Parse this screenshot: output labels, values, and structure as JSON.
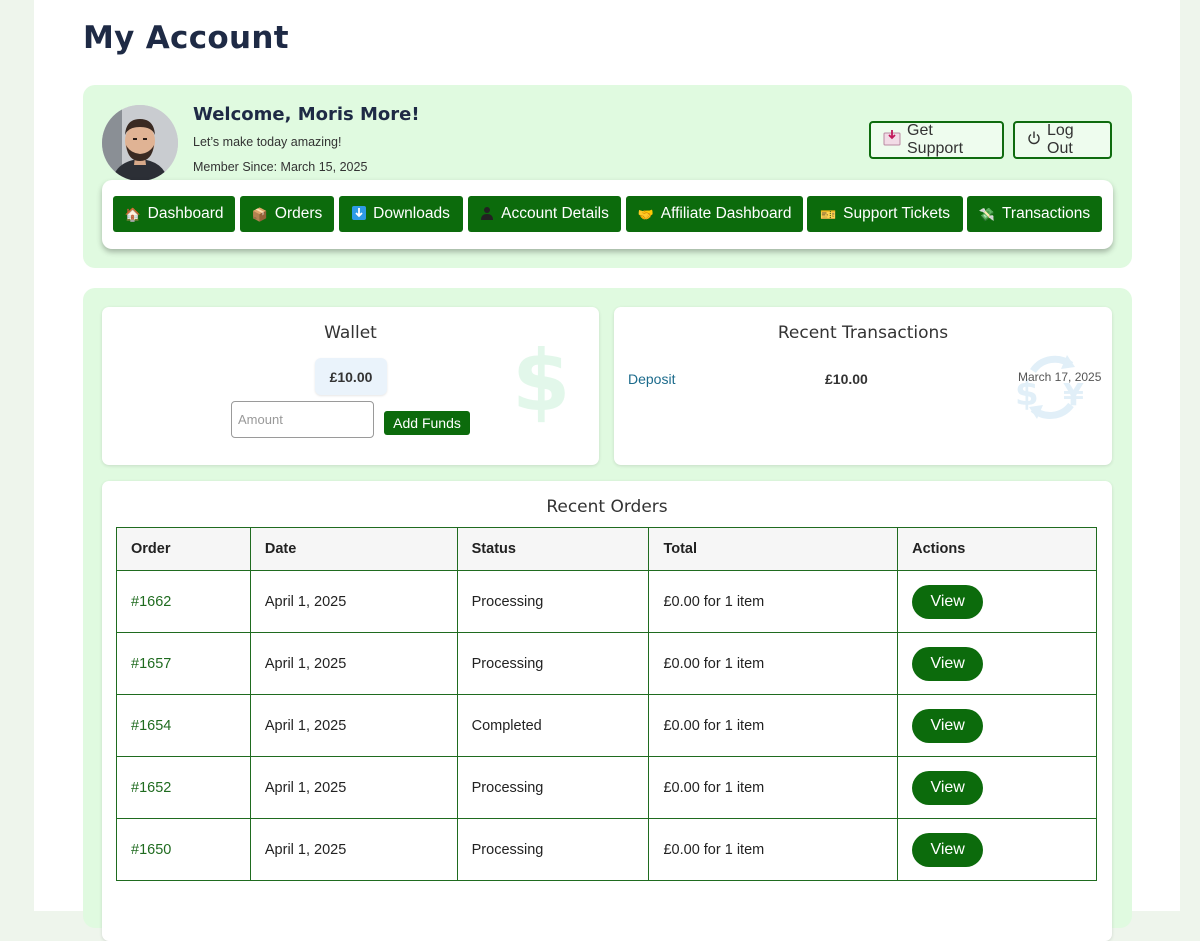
{
  "page": {
    "title": "My Account"
  },
  "user": {
    "welcome": "Welcome, Moris More!",
    "tagline": "Let’s make today amazing!",
    "member_since": "Member Since: March 15, 2025"
  },
  "header_actions": {
    "support_label": "Get Support",
    "support_icon": "inbox-tray-icon",
    "logout_label": "Log Out",
    "logout_icon": "power-icon"
  },
  "nav": {
    "items": [
      {
        "label": "Dashboard",
        "icon": "house-icon"
      },
      {
        "label": "Orders",
        "icon": "package-icon"
      },
      {
        "label": "Downloads",
        "icon": "download-arrow-icon"
      },
      {
        "label": "Account Details",
        "icon": "user-silhouette-icon"
      },
      {
        "label": "Affiliate Dashboard",
        "icon": "handshake-icon"
      },
      {
        "label": "Support Tickets",
        "icon": "ticket-icon"
      },
      {
        "label": "Transactions",
        "icon": "money-wings-icon"
      }
    ]
  },
  "wallet": {
    "title": "Wallet",
    "balance": "£10.00",
    "amount_placeholder": "Amount",
    "add_funds_label": "Add Funds"
  },
  "transactions": {
    "title": "Recent Transactions",
    "items": [
      {
        "type": "Deposit",
        "amount": "£10.00",
        "date": "March 17, 2025"
      }
    ]
  },
  "orders": {
    "title": "Recent Orders",
    "columns": [
      "Order",
      "Date",
      "Status",
      "Total",
      "Actions"
    ],
    "view_label": "View",
    "rows": [
      {
        "order": "#1662",
        "date": "April 1, 2025",
        "status": "Processing",
        "total": "£0.00 for 1 item"
      },
      {
        "order": "#1657",
        "date": "April 1, 2025",
        "status": "Processing",
        "total": "£0.00 for 1 item"
      },
      {
        "order": "#1654",
        "date": "April 1, 2025",
        "status": "Completed",
        "total": "£0.00 for 1 item"
      },
      {
        "order": "#1652",
        "date": "April 1, 2025",
        "status": "Processing",
        "total": "£0.00 for 1 item"
      },
      {
        "order": "#1650",
        "date": "April 1, 2025",
        "status": "Processing",
        "total": "£0.00 for 1 item"
      }
    ]
  },
  "colors": {
    "brand_green": "#0c6b0c",
    "panel_green": "#e0fae0",
    "heading_navy": "#1e2a45",
    "link_blue": "#1c6b8c"
  }
}
